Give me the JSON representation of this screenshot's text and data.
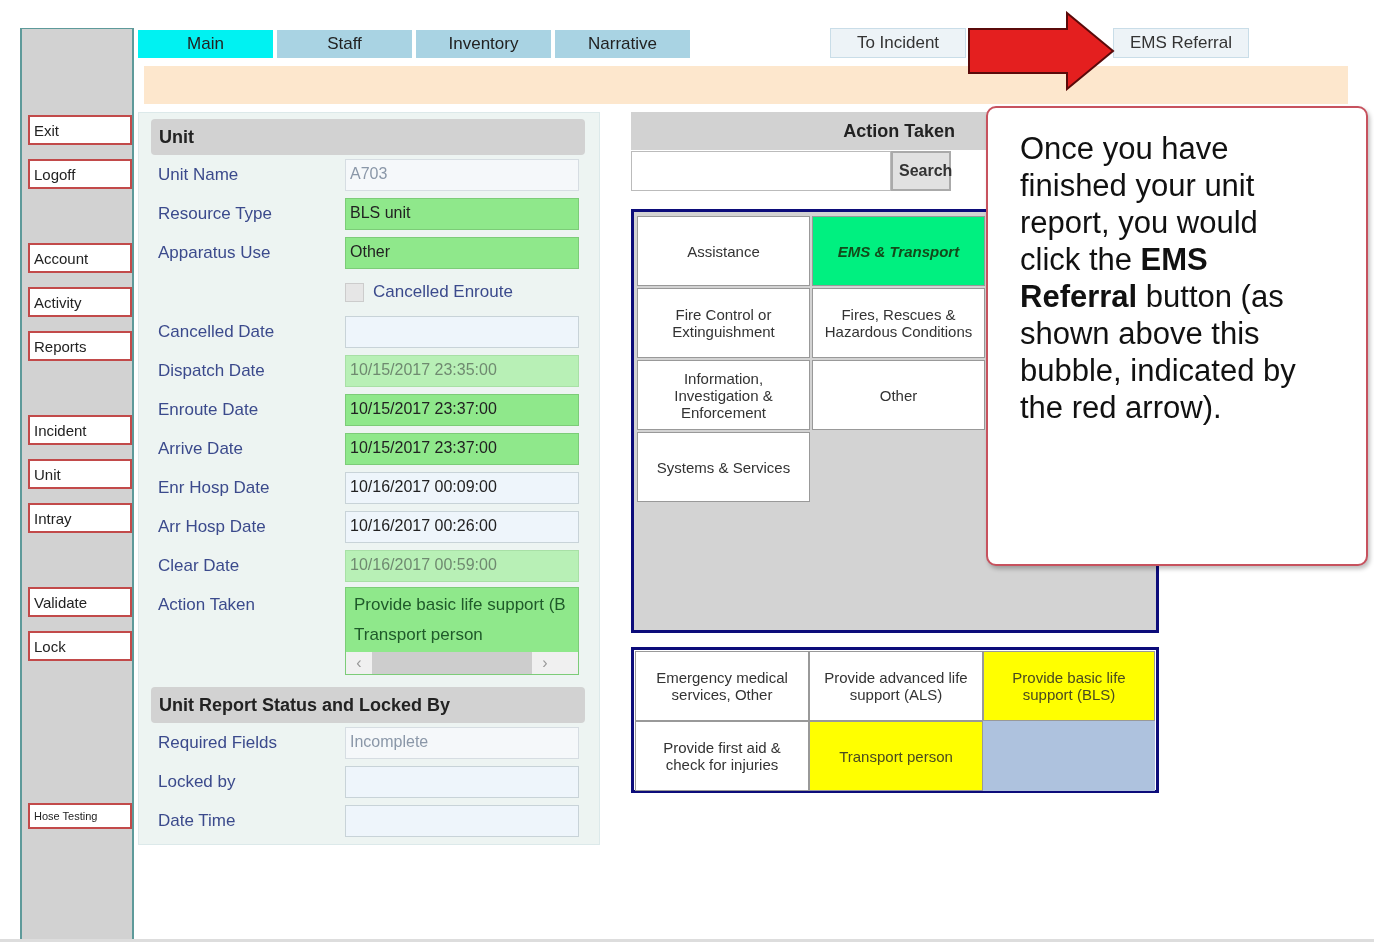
{
  "sidebar": {
    "groups": [
      {
        "small": false,
        "items": [
          "Exit",
          "Logoff"
        ]
      },
      {
        "small": false,
        "items": [
          "Account",
          "Activity",
          "Reports"
        ]
      },
      {
        "small": false,
        "items": [
          "Incident",
          "Unit",
          "Intray"
        ]
      },
      {
        "small": false,
        "items": [
          "Validate",
          "Lock"
        ]
      },
      {
        "small": true,
        "items": [
          "Hose Testing"
        ]
      }
    ]
  },
  "tabs": [
    {
      "label": "Main",
      "selected": true
    },
    {
      "label": "Staff",
      "selected": false
    },
    {
      "label": "Inventory",
      "selected": false
    },
    {
      "label": "Narrative",
      "selected": false
    }
  ],
  "top_buttons": [
    "To Incident",
    "EMS Referral"
  ],
  "unit": {
    "title": "Unit",
    "rows": [
      {
        "kind": "field",
        "label": "Unit Name",
        "value": "A703",
        "readonly": true,
        "valid": false
      },
      {
        "kind": "field",
        "label": "Resource Type",
        "value": "BLS unit",
        "readonly": false,
        "valid": true
      },
      {
        "kind": "field",
        "label": "Apparatus Use",
        "value": "Other",
        "readonly": false,
        "valid": true
      },
      {
        "kind": "checkbox",
        "label": "Cancelled Enroute",
        "checked": false
      },
      {
        "kind": "field",
        "label": "Cancelled Date",
        "readonly": false,
        "valid": false
      },
      {
        "kind": "field",
        "label": "Dispatch Date",
        "value": "10/15/2017 23:35:00",
        "readonly": true,
        "valid": true
      },
      {
        "kind": "field",
        "label": "Enroute Date",
        "value": "10/15/2017 23:37:00",
        "readonly": false,
        "valid": true
      },
      {
        "kind": "field",
        "label": "Arrive Date",
        "value": "10/15/2017 23:37:00",
        "readonly": false,
        "valid": true
      },
      {
        "kind": "field",
        "label": "Enr Hosp Date",
        "value": "10/16/2017 00:09:00",
        "readonly": false,
        "valid": false
      },
      {
        "kind": "field",
        "label": "Arr Hosp Date",
        "value": "10/16/2017 00:26:00",
        "readonly": false,
        "valid": false
      },
      {
        "kind": "field",
        "label": "Clear Date",
        "value": "10/16/2017 00:59:00",
        "readonly": true,
        "valid": true
      },
      {
        "kind": "list",
        "label": "Action Taken",
        "items": [
          "Provide basic life support (B",
          "Transport person"
        ],
        "scroll_left": "‹",
        "scroll_right": "›"
      }
    ]
  },
  "status": {
    "title": "Unit Report Status and Locked By",
    "rows": [
      {
        "kind": "field",
        "label": "Required Fields",
        "value": "Incomplete",
        "readonly": true,
        "valid": false
      },
      {
        "kind": "field",
        "label": "Locked by",
        "readonly": false,
        "valid": false
      },
      {
        "kind": "field",
        "label": "Date Time",
        "readonly": false,
        "valid": false
      }
    ]
  },
  "action_taken": {
    "title": "Action Taken",
    "search_button": "Search",
    "categories": [
      {
        "label": "Assistance",
        "selected": false
      },
      {
        "label": "EMS & Transport",
        "selected": true
      },
      {
        "label": "Fire Control or Extinguishment",
        "selected": false
      },
      {
        "label": "Fires, Rescues & Hazardous Conditions",
        "selected": false
      },
      {
        "label": "Information, Investigation & Enforcement",
        "selected": false
      },
      {
        "label": "Other",
        "selected": false
      },
      {
        "label": "Systems & Services",
        "selected": false
      }
    ],
    "actions": [
      {
        "label": "Emergency medical services, Other",
        "selected": false
      },
      {
        "label": "Provide advanced life support (ALS)",
        "selected": false
      },
      {
        "label": "Provide basic life support (BLS)",
        "selected": true
      },
      {
        "label": "Provide first aid & check for injuries",
        "selected": false
      },
      {
        "label": "Transport person",
        "selected": true
      }
    ]
  },
  "callout": {
    "text": "Once you have finished your unit report, you would click the **EMS Referral** button (as shown above this bubble, indicated by the red arrow)."
  }
}
